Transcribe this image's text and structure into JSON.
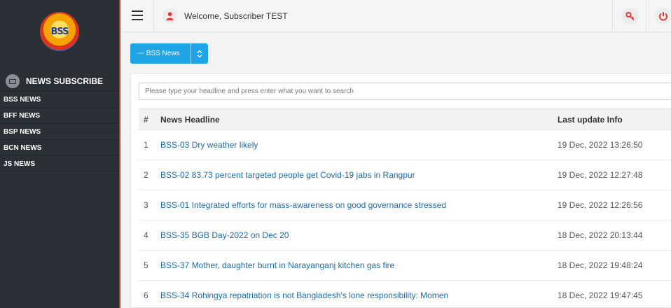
{
  "sidebar": {
    "logo_text": "BSS",
    "section_title": "NEWS SUBSCRIBE",
    "items": [
      {
        "label": "BSS NEWS"
      },
      {
        "label": "BFF NEWS"
      },
      {
        "label": "BSP NEWS"
      },
      {
        "label": "BCN NEWS"
      },
      {
        "label": "JS NEWS"
      }
    ]
  },
  "header": {
    "welcome": "Welcome, Subscriber TEST"
  },
  "selector": {
    "value": "--- BSS News"
  },
  "search": {
    "placeholder": "Please type your headline and press enter what you want to search"
  },
  "table": {
    "columns": [
      "#",
      "News Headline",
      "Last update Info"
    ],
    "rows": [
      {
        "num": "1",
        "headline": "BSS-03 Dry weather likely",
        "updated": "19 Dec, 2022 13:26:50"
      },
      {
        "num": "2",
        "headline": "BSS-02 83.73 percent targeted people get Covid-19 jabs in Rangpur",
        "updated": "19 Dec, 2022 12:27:48"
      },
      {
        "num": "3",
        "headline": "BSS-01 Integrated efforts for mass-awareness on good governance stressed",
        "updated": "19 Dec, 2022 12:26:56"
      },
      {
        "num": "4",
        "headline": "BSS-35 BGB Day-2022 on Dec 20",
        "updated": "18 Dec, 2022 20:13:44"
      },
      {
        "num": "5",
        "headline": "BSS-37 Mother, daughter burnt in Narayanganj kitchen gas fire",
        "updated": "18 Dec, 2022 19:48:24"
      },
      {
        "num": "6",
        "headline": "BSS-34 Rohingya repatriation is not Bangladesh's lone responsibility: Momen",
        "updated": "18 Dec, 2022 19:47:45"
      }
    ]
  },
  "colors": {
    "sidebar_bg": "#2b3036",
    "accent": "#1fa4e6",
    "link": "#1f6aa5",
    "danger": "#e53935"
  },
  "icons": {
    "menu": "hamburger-icon",
    "user": "user-icon",
    "key": "key-icon",
    "power": "power-icon",
    "section": "newspaper-icon",
    "select": "chevron-updown-icon"
  }
}
